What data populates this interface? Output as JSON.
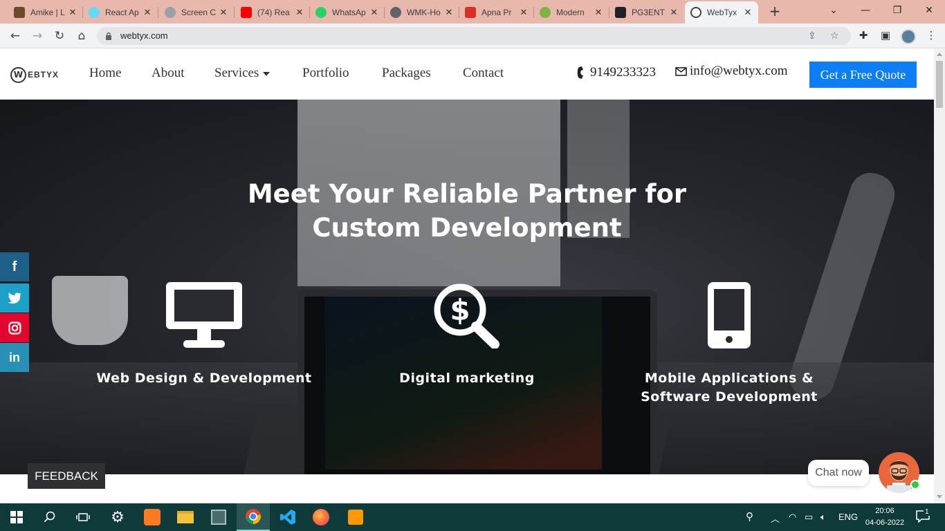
{
  "browser": {
    "tabs": [
      {
        "label": "Amike | L",
        "favicon_color": "#6b4a2b"
      },
      {
        "label": "React Ap",
        "favicon_color": "#61dafb"
      },
      {
        "label": "Screen C",
        "favicon_color": "#9aa0a6"
      },
      {
        "label": "(74) Rea",
        "favicon_color": "#ff0000"
      },
      {
        "label": "WhatsAp",
        "favicon_color": "#25d366"
      },
      {
        "label": "WMK-Ho",
        "favicon_color": "#5f6368"
      },
      {
        "label": "Apna Pr",
        "favicon_color": "#d93025"
      },
      {
        "label": "Modern",
        "favicon_color": "#7cb342"
      },
      {
        "label": "PG3ENT",
        "favicon_color": "#202124"
      },
      {
        "label": "WebTyx",
        "favicon_color": "#444444",
        "active": true
      }
    ],
    "new_tab_symbol": "+",
    "url": "webtyx.com"
  },
  "site": {
    "logo_mark": "W",
    "logo_text": "EBTYX",
    "nav": {
      "home": "Home",
      "about": "About",
      "services": "Services",
      "portfolio": "Portfolio",
      "packages": "Packages",
      "contact": "Contact"
    },
    "phone": "9149233323",
    "email": "info@webtyx.com",
    "cta_label": "Get a Free Quote",
    "cta_color": "#0d7ef5"
  },
  "hero": {
    "title": "Meet Your Reliable Partner for Custom Development",
    "services": [
      {
        "label": "Web Design & Development",
        "icon": "desktop-monitor-icon"
      },
      {
        "label": "Digital marketing",
        "icon": "dollar-search-icon"
      },
      {
        "label": "Mobile Applications & Software Development",
        "icon": "mobile-phone-icon"
      }
    ]
  },
  "social": [
    {
      "name": "facebook",
      "glyph": "f",
      "color": "#1d5f86"
    },
    {
      "name": "twitter",
      "glyph": "t",
      "color": "#1da1c8"
    },
    {
      "name": "instagram",
      "glyph": "ig",
      "color": "#e4062d"
    },
    {
      "name": "linkedin",
      "glyph": "in",
      "color": "#2a8fb5"
    }
  ],
  "widgets": {
    "feedback_label": "FEEDBACK",
    "chat_label": "Chat now"
  },
  "taskbar": {
    "language": "ENG",
    "time": "20:06",
    "date": "04-06-2022",
    "notification_count": "1"
  }
}
